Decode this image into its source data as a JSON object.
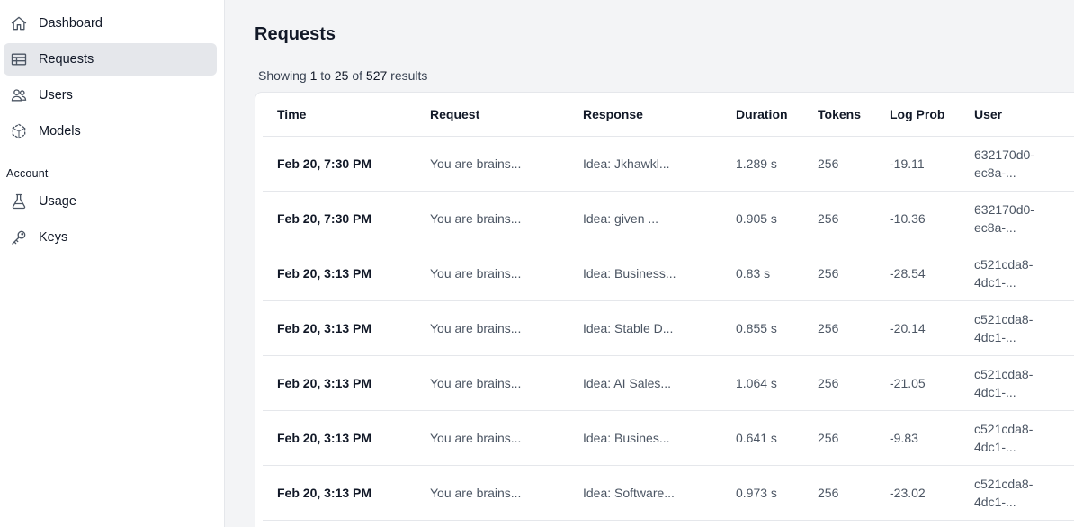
{
  "sidebar": {
    "items": [
      {
        "label": "Dashboard",
        "icon": "home-icon",
        "active": false
      },
      {
        "label": "Requests",
        "icon": "table-icon",
        "active": true
      },
      {
        "label": "Users",
        "icon": "users-icon",
        "active": false
      },
      {
        "label": "Models",
        "icon": "cube-icon",
        "active": false
      }
    ],
    "account_label": "Account",
    "account_items": [
      {
        "label": "Usage",
        "icon": "beaker-icon"
      },
      {
        "label": "Keys",
        "icon": "key-icon"
      }
    ]
  },
  "main": {
    "title": "Requests",
    "summary": {
      "prefix": "Showing",
      "from": "1",
      "to_word": "to",
      "to": "25",
      "of_word": "of",
      "total": "527",
      "suffix": "results"
    },
    "table": {
      "columns": [
        "Time",
        "Request",
        "Response",
        "Duration",
        "Tokens",
        "Log Prob",
        "User"
      ],
      "rows": [
        {
          "time": "Feb 20, 7:30 PM",
          "request": "You are brains...",
          "response": "Idea: Jkhawkl...",
          "duration": "1.289 s",
          "tokens": "256",
          "logprob": "-19.11",
          "user1": "632170d0-",
          "user2": "ec8a-..."
        },
        {
          "time": "Feb 20, 7:30 PM",
          "request": "You are brains...",
          "response": "Idea: given ...",
          "duration": "0.905 s",
          "tokens": "256",
          "logprob": "-10.36",
          "user1": "632170d0-",
          "user2": "ec8a-..."
        },
        {
          "time": "Feb 20, 3:13 PM",
          "request": "You are brains...",
          "response": "Idea: Business...",
          "duration": "0.83 s",
          "tokens": "256",
          "logprob": "-28.54",
          "user1": "c521cda8-",
          "user2": "4dc1-..."
        },
        {
          "time": "Feb 20, 3:13 PM",
          "request": "You are brains...",
          "response": "Idea: Stable D...",
          "duration": "0.855 s",
          "tokens": "256",
          "logprob": "-20.14",
          "user1": "c521cda8-",
          "user2": "4dc1-..."
        },
        {
          "time": "Feb 20, 3:13 PM",
          "request": "You are brains...",
          "response": "Idea: AI Sales...",
          "duration": "1.064 s",
          "tokens": "256",
          "logprob": "-21.05",
          "user1": "c521cda8-",
          "user2": "4dc1-..."
        },
        {
          "time": "Feb 20, 3:13 PM",
          "request": "You are brains...",
          "response": "Idea: Busines...",
          "duration": "0.641 s",
          "tokens": "256",
          "logprob": "-9.83",
          "user1": "c521cda8-",
          "user2": "4dc1-..."
        },
        {
          "time": "Feb 20, 3:13 PM",
          "request": "You are brains...",
          "response": "Idea: Software...",
          "duration": "0.973 s",
          "tokens": "256",
          "logprob": "-23.02",
          "user1": "c521cda8-",
          "user2": "4dc1-..."
        }
      ]
    }
  },
  "colors": {
    "sidebar_bg": "#ffffff",
    "active_item_bg": "#e5e7eb",
    "main_bg": "#f3f4f6",
    "text_primary": "#111827",
    "text_secondary": "#4b5563",
    "border": "#e5e7eb"
  }
}
